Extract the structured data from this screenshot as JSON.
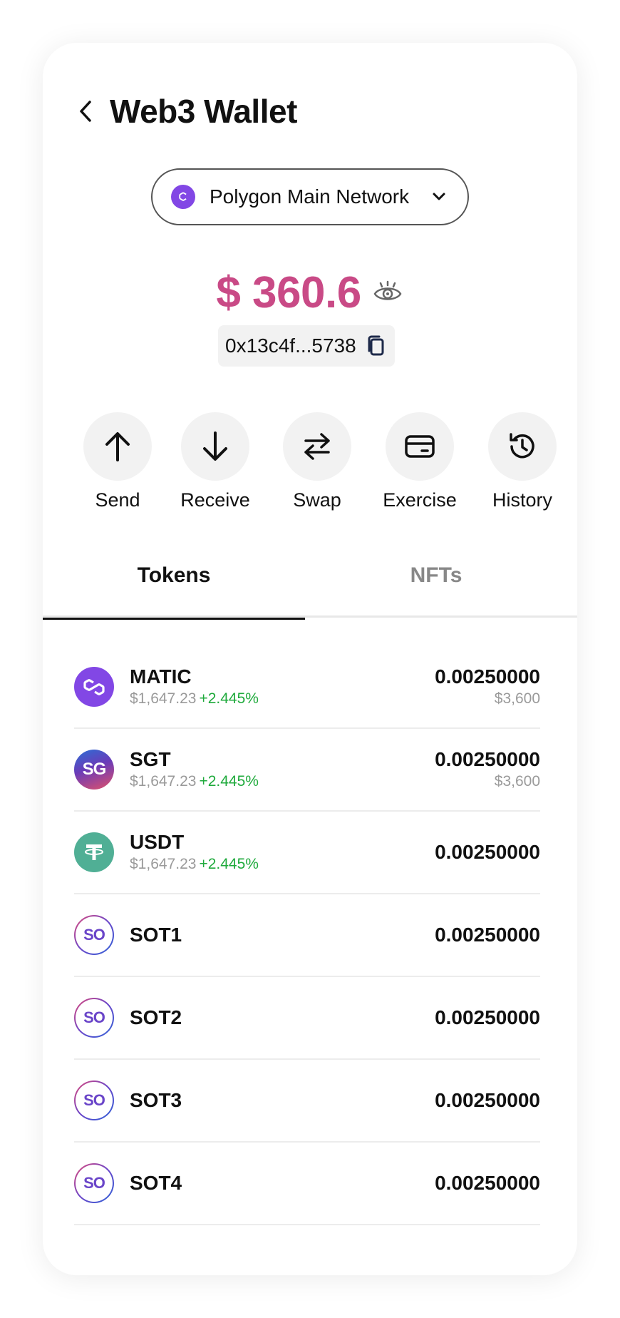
{
  "header": {
    "title": "Web3 Wallet"
  },
  "network": {
    "label": "Polygon Main Network"
  },
  "wallet": {
    "balance": "$ 360.6",
    "address": "0x13c4f...5738"
  },
  "actions": [
    {
      "label": "Send",
      "icon": "arrow-up-icon"
    },
    {
      "label": "Receive",
      "icon": "arrow-down-icon"
    },
    {
      "label": "Swap",
      "icon": "swap-icon"
    },
    {
      "label": "Exercise",
      "icon": "card-icon"
    },
    {
      "label": "History",
      "icon": "history-icon"
    }
  ],
  "tabs": [
    {
      "label": "Tokens",
      "active": true
    },
    {
      "label": "NFTs",
      "active": false
    }
  ],
  "tokens": [
    {
      "symbol": "MATIC",
      "price": "$1,647.23",
      "change": "+2.445%",
      "amount": "0.00250000",
      "value": "$3,600",
      "logo": "matic-logo-icon"
    },
    {
      "symbol": "SGT",
      "price": "$1,647.23",
      "change": "+2.445%",
      "amount": "0.00250000",
      "value": "$3,600",
      "logo": "sgt-logo-icon",
      "logo_text": "SG"
    },
    {
      "symbol": "USDT",
      "price": "$1,647.23",
      "change": "+2.445%",
      "amount": "0.00250000",
      "value": "",
      "logo": "usdt-logo-icon"
    },
    {
      "symbol": "SOT1",
      "amount": "0.00250000",
      "logo": "so-logo-icon",
      "logo_text": "SO"
    },
    {
      "symbol": "SOT2",
      "amount": "0.00250000",
      "logo": "so-logo-icon",
      "logo_text": "SO"
    },
    {
      "symbol": "SOT3",
      "amount": "0.00250000",
      "logo": "so-logo-icon",
      "logo_text": "SO"
    },
    {
      "symbol": "SOT4",
      "amount": "0.00250000",
      "logo": "so-logo-icon",
      "logo_text": "SO"
    }
  ],
  "colors": {
    "balance": "#c94a86",
    "change_positive": "#1faa3c",
    "polygon": "#8247e5",
    "usdt": "#50af95"
  }
}
